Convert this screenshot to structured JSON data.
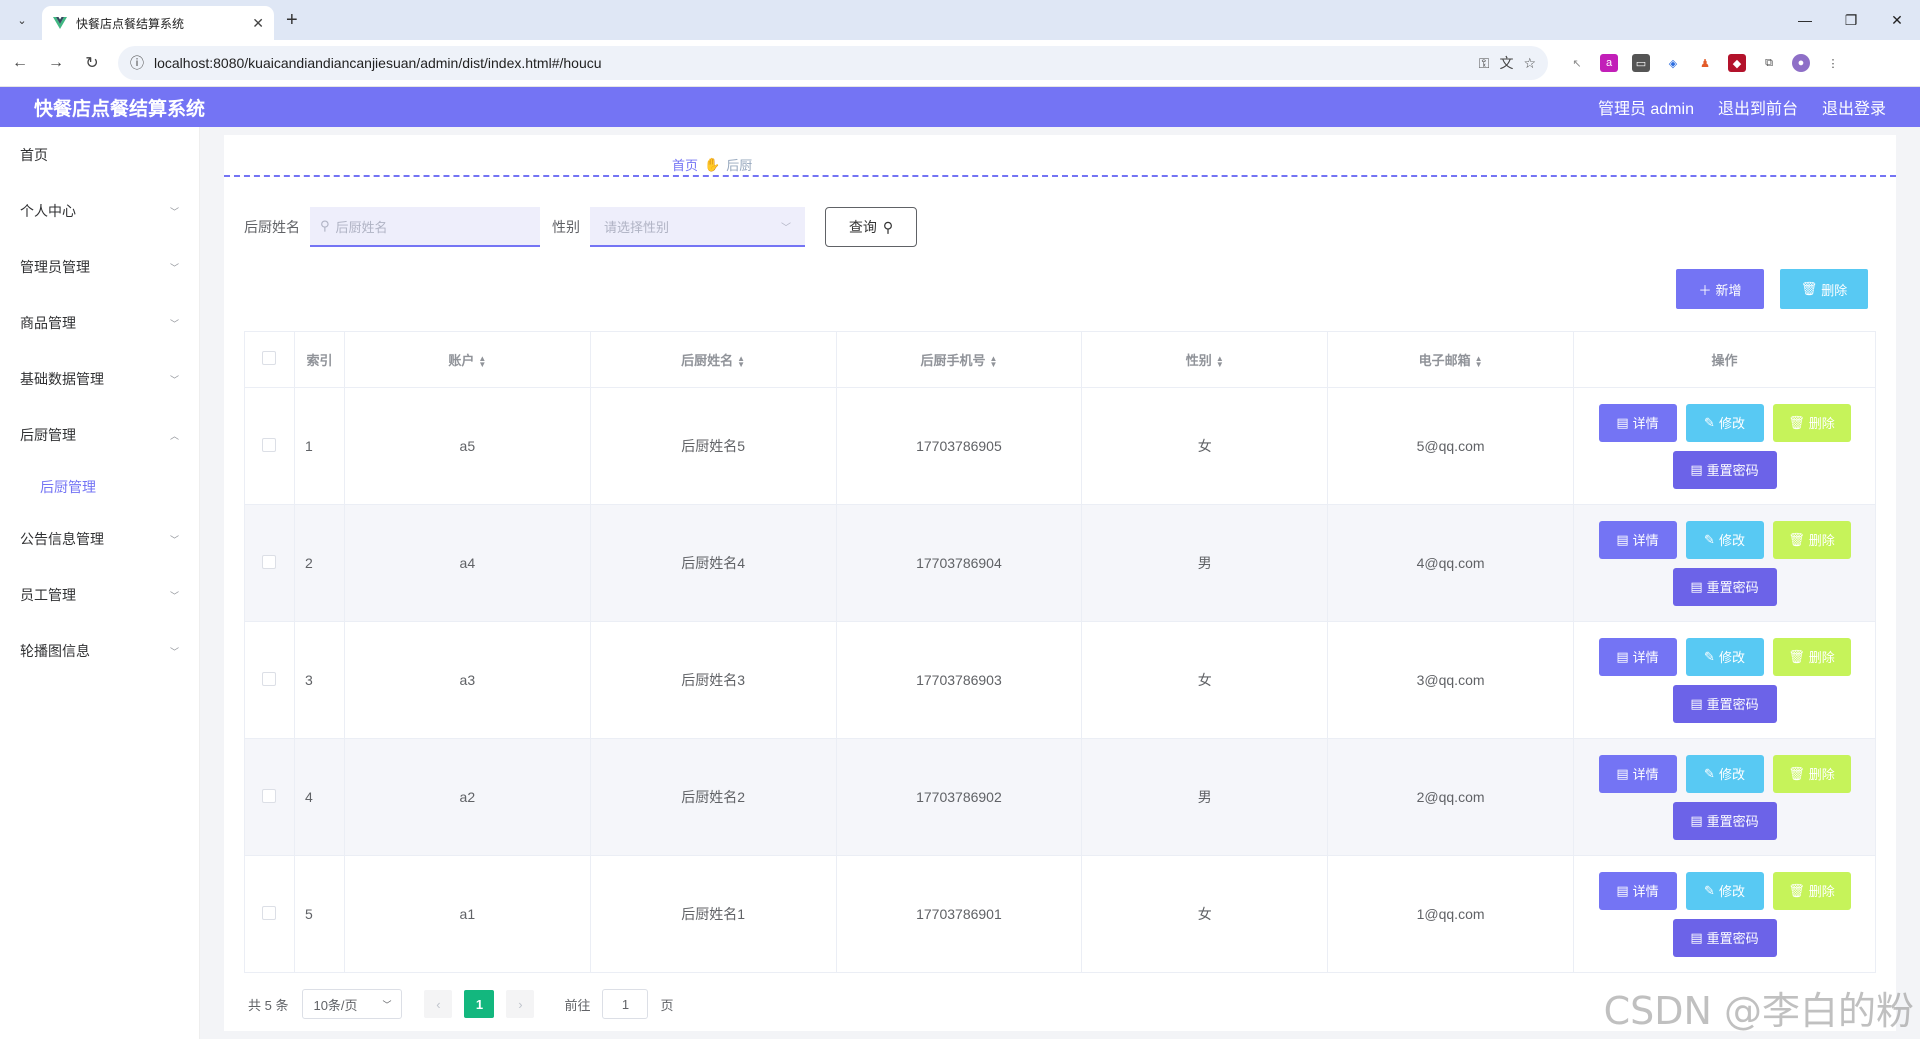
{
  "browser": {
    "tab_title": "快餐店点餐结算系统",
    "url": "localhost:8080/kuaicandiandiancanjiesuan/admin/dist/index.html#/houcu",
    "new_tab": "+",
    "tab_close": "✕"
  },
  "header": {
    "title": "快餐店点餐结算系统",
    "admin_label": "管理员 admin",
    "exit_front": "退出到前台",
    "logout": "退出登录"
  },
  "sidebar": {
    "items": [
      {
        "label": "首页",
        "has_chevron": false
      },
      {
        "label": "个人中心"
      },
      {
        "label": "管理员管理"
      },
      {
        "label": "商品管理"
      },
      {
        "label": "基础数据管理"
      },
      {
        "label": "后厨管理"
      },
      {
        "label": "公告信息管理"
      },
      {
        "label": "员工管理"
      },
      {
        "label": "轮播图信息"
      }
    ],
    "sub_item": "后厨管理"
  },
  "breadcrumb": {
    "home": "首页",
    "current": "后厨"
  },
  "search": {
    "name_label": "后厨姓名",
    "name_placeholder": "后厨姓名",
    "gender_label": "性别",
    "gender_placeholder": "请选择性别",
    "query_button": "查询"
  },
  "actions": {
    "add": "新增",
    "delete": "删除"
  },
  "table": {
    "headers": [
      "索引",
      "账户",
      "后厨姓名",
      "后厨手机号",
      "性别",
      "电子邮箱",
      "操作"
    ],
    "rows": [
      {
        "index": "1",
        "account": "a5",
        "name": "后厨姓名5",
        "phone": "17703786905",
        "gender": "女",
        "email": "5@qq.com"
      },
      {
        "index": "2",
        "account": "a4",
        "name": "后厨姓名4",
        "phone": "17703786904",
        "gender": "男",
        "email": "4@qq.com"
      },
      {
        "index": "3",
        "account": "a3",
        "name": "后厨姓名3",
        "phone": "17703786903",
        "gender": "女",
        "email": "3@qq.com"
      },
      {
        "index": "4",
        "account": "a2",
        "name": "后厨姓名2",
        "phone": "17703786902",
        "gender": "男",
        "email": "2@qq.com"
      },
      {
        "index": "5",
        "account": "a1",
        "name": "后厨姓名1",
        "phone": "17703786901",
        "gender": "女",
        "email": "1@qq.com"
      }
    ],
    "op_labels": {
      "detail": "详情",
      "edit": "修改",
      "delete": "删除",
      "reset": "重置密码"
    }
  },
  "pagination": {
    "total": "共 5 条",
    "page_size": "10条/页",
    "current_page": "1",
    "goto_prefix": "前往",
    "goto_value": "1",
    "goto_suffix": "页"
  },
  "watermark": "CSDN @李白的粉",
  "colors": {
    "primary": "#7474f4",
    "info": "#58c9f3",
    "warning": "#c6f35a",
    "reset": "#6c63e8",
    "pager_active": "#13b77e"
  }
}
